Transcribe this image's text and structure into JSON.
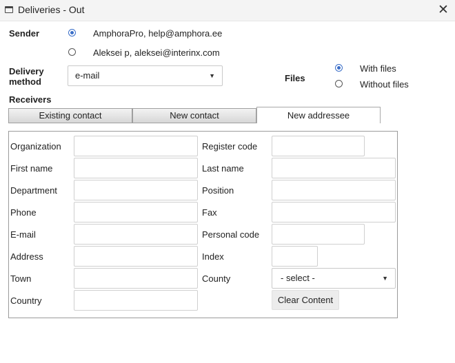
{
  "window": {
    "title": "Deliveries - Out",
    "icon": "window-icon",
    "close": "✕"
  },
  "sender": {
    "label": "Sender",
    "options": [
      {
        "label": "AmphoraPro, help@amphora.ee",
        "checked": true
      },
      {
        "label": "Aleksei p, aleksei@interinx.com",
        "checked": false
      }
    ]
  },
  "delivery": {
    "label_line1": "Delivery",
    "label_line2": "method",
    "value": "e-mail"
  },
  "files": {
    "label": "Files",
    "options": [
      {
        "label": "With files",
        "checked": true
      },
      {
        "label": "Without files",
        "checked": false
      }
    ]
  },
  "receivers": {
    "label": "Receivers",
    "tabs": [
      {
        "label": "Existing contact",
        "active": false
      },
      {
        "label": "New contact",
        "active": false
      },
      {
        "label": "New addressee",
        "active": true
      }
    ]
  },
  "form": {
    "left": [
      {
        "label": "Organization",
        "value": ""
      },
      {
        "label": "First name",
        "value": ""
      },
      {
        "label": "Department",
        "value": ""
      },
      {
        "label": "Phone",
        "value": ""
      },
      {
        "label": "E-mail",
        "value": ""
      },
      {
        "label": "Address",
        "value": ""
      },
      {
        "label": "Town",
        "value": ""
      },
      {
        "label": "Country",
        "value": ""
      }
    ],
    "right": [
      {
        "label": "Register code",
        "value": ""
      },
      {
        "label": "Last name",
        "value": ""
      },
      {
        "label": "Position",
        "value": ""
      },
      {
        "label": "Fax",
        "value": ""
      },
      {
        "label": "Personal code",
        "value": ""
      },
      {
        "label": "Index",
        "value": ""
      },
      {
        "label": "County",
        "value": "- select -"
      }
    ],
    "clear_label": "Clear Content"
  },
  "colors": {
    "accent": "#3a6ec8",
    "titlebar": "#f4f4f4",
    "panel_border": "#9a9a9a"
  }
}
